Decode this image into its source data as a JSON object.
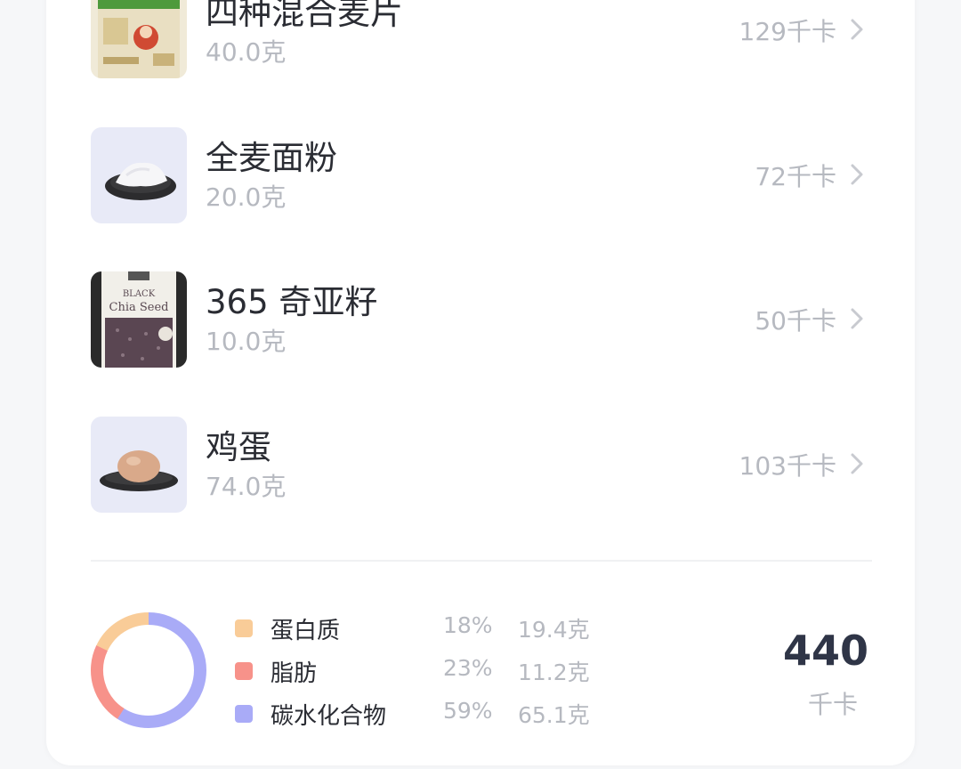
{
  "foods": [
    {
      "name": "四种混合麦片",
      "weight": "40.0克",
      "kcal": "129千卡",
      "image_icon": "oat-cereal-box-icon"
    },
    {
      "name": "全麦面粉",
      "weight": "20.0克",
      "kcal": "72千卡",
      "image_icon": "flour-plate-icon"
    },
    {
      "name": "365 奇亚籽",
      "weight": "10.0克",
      "kcal": "50千卡",
      "image_icon": "chia-seed-bag-icon",
      "package_label_1": "BLACK",
      "package_label_2": "Chia Seed"
    },
    {
      "name": "鸡蛋",
      "weight": "74.0克",
      "kcal": "103千卡",
      "image_icon": "egg-plate-icon"
    }
  ],
  "nutrition": {
    "items": [
      {
        "label": "蛋白质",
        "percent": "18%",
        "grams": "19.4克",
        "color": "#f9cc98"
      },
      {
        "label": "脂肪",
        "percent": "23%",
        "grams": "11.2克",
        "color": "#f7928a"
      },
      {
        "label": "碳水化合物",
        "percent": "59%",
        "grams": "65.1克",
        "color": "#a9abf7"
      }
    ],
    "donut_fractions": [
      0.18,
      0.23,
      0.59
    ],
    "total_value": "440",
    "total_unit": "千卡"
  },
  "colors": {
    "title_text": "#2a2c33",
    "secondary_text": "#b6b9c0",
    "total_text": "#2f3547"
  }
}
